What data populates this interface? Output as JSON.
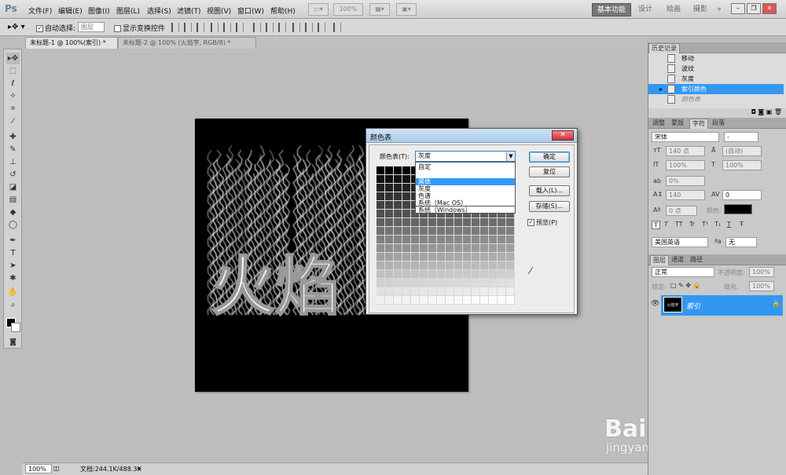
{
  "app": {
    "logo": "Ps",
    "menus": [
      "文件(F)",
      "编辑(E)",
      "图像(I)",
      "图层(L)",
      "选择(S)",
      "滤镜(T)",
      "视图(V)",
      "窗口(W)",
      "帮助(H)"
    ],
    "zoom_control": "100%",
    "workspaces": [
      "基本功能",
      "设计",
      "绘画",
      "摄影"
    ],
    "workspace_more": "»"
  },
  "options_bar": {
    "auto_select_label": "自动选择:",
    "auto_select_checked": true,
    "auto_select_target": "图层",
    "show_transform_label": "显示变换控件",
    "show_transform_checked": false
  },
  "document_tabs": [
    {
      "label": "未标题-1 @ 100%(索引) *",
      "active": true
    },
    {
      "label": "未标题-2 @ 100% (火焰字, RGB/8) *",
      "active": false
    }
  ],
  "canvas": {
    "text": "火焰"
  },
  "status_bar": {
    "zoom": "100%",
    "doc_size": "文档:244.1K/488.3K"
  },
  "watermark": {
    "brand": "Baidu经验",
    "url": "jingyan.baidu.com"
  },
  "history_panel": {
    "title": "历史记录",
    "items": [
      {
        "label": "移动",
        "state": "normal"
      },
      {
        "label": "波纹",
        "state": "normal"
      },
      {
        "label": "灰度",
        "state": "normal"
      },
      {
        "label": "索引颜色",
        "state": "selected"
      },
      {
        "label": "颜色表",
        "state": "dim"
      }
    ]
  },
  "character_panel": {
    "tabs": [
      "调整",
      "蒙版",
      "字符",
      "段落"
    ],
    "active_tab": "字符",
    "font_family": "宋体",
    "font_style": "-",
    "font_size": "140 点",
    "leading": "(自动)",
    "vertical_scale": "100%",
    "horizontal_scale": "100%",
    "tracking": "0%",
    "kerning": "140",
    "kerning2": "0",
    "baseline_shift": "0 点",
    "color_label": "颜色:",
    "color": "#000000",
    "language": "美国英语",
    "anti_alias_prefix": "ªa",
    "anti_alias": "无",
    "style_buttons": [
      "T",
      "T",
      "TT",
      "Tr",
      "T¹",
      "T₁",
      "T",
      "Ŧ"
    ]
  },
  "layers_panel": {
    "tabs": [
      "图层",
      "通道",
      "路径"
    ],
    "active_tab": "图层",
    "blend_mode": "正常",
    "opacity_label": "不透明度:",
    "opacity": "100%",
    "lock_label": "锁定:",
    "fill_label": "填充:",
    "fill": "100%",
    "layer_name": "索引",
    "thumb_text": "火焰字"
  },
  "color_table_dialog": {
    "title": "颜色表",
    "close_label": "✕",
    "table_label": "颜色表(T):",
    "table_value": "灰度",
    "dropdown_options": [
      {
        "label": "自定",
        "highlighted": false
      },
      {
        "label": "黑体",
        "highlighted": true
      },
      {
        "label": "灰度",
        "highlighted": false
      },
      {
        "label": "色谱",
        "highlighted": false
      },
      {
        "label": "系统（Mac OS）",
        "highlighted": false
      },
      {
        "label": "系统（Windows）",
        "highlighted": false
      }
    ],
    "buttons": {
      "ok": "确定",
      "reset": "复位",
      "load": "载入(L)...",
      "save": "存储(S)..."
    },
    "preview_label": "预览(P)",
    "preview_checked": true,
    "eyedropper_icon": "eyedropper-icon"
  }
}
